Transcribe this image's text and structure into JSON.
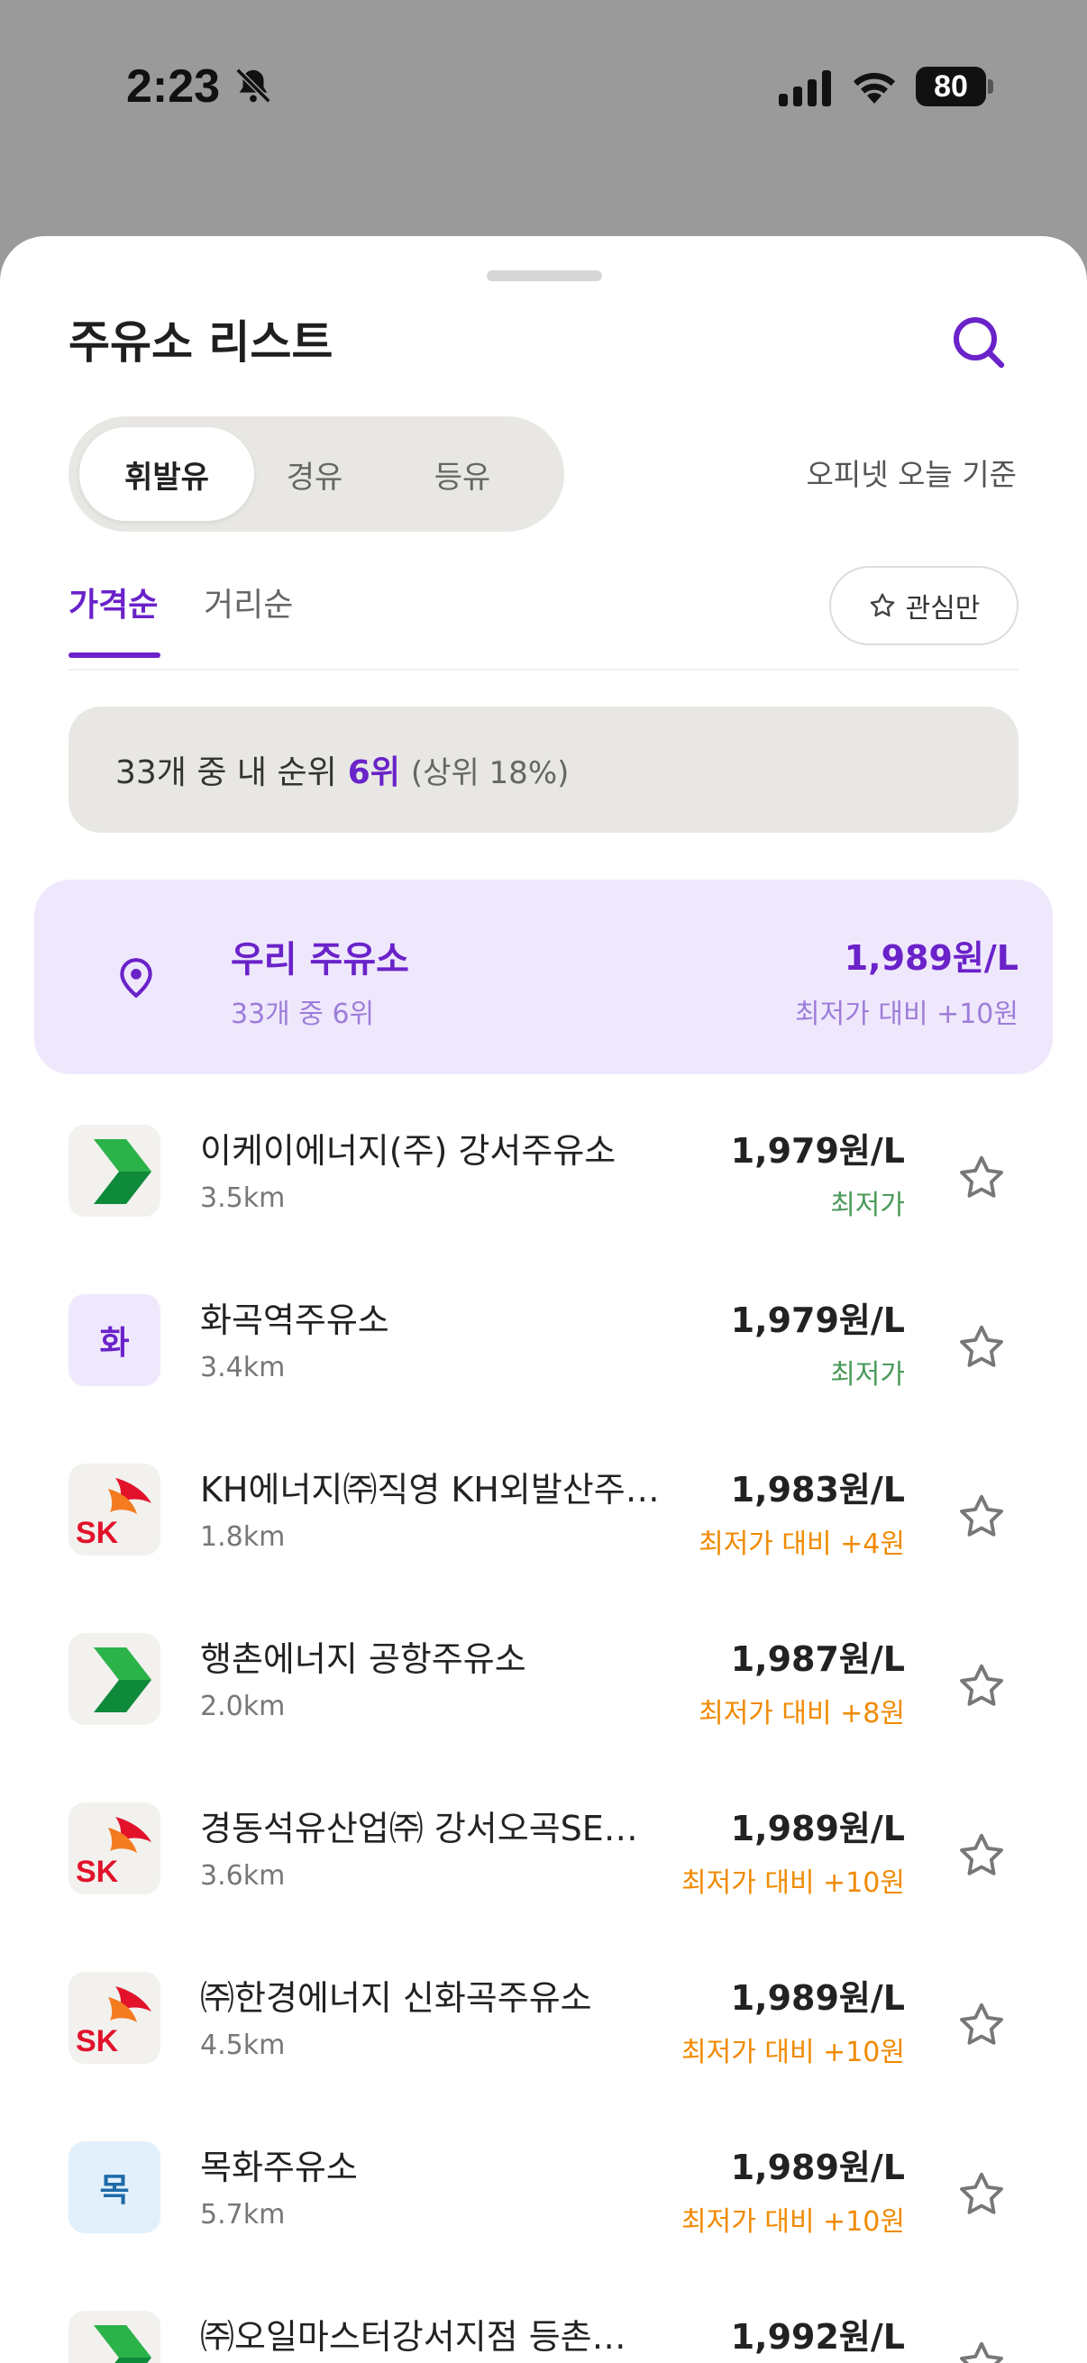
{
  "status_bar": {
    "time": "2:23",
    "battery": "80"
  },
  "sheet": {
    "title": "주유소 리스트",
    "fuel_types": [
      "휘발유",
      "경유",
      "등유"
    ],
    "selected_fuel": "휘발유",
    "note": "오피넷 오늘 기준",
    "sort_tabs": [
      "가격순",
      "거리순"
    ],
    "favorites_only_label": "관심만",
    "rank": {
      "prefix": "33개 중 내 순위",
      "rank": "6위",
      "sub": "(상위 18%)"
    },
    "my_station": {
      "name": "우리 주유소",
      "rank_text": "33개 중 6위",
      "price": "1,989원/L",
      "diff": "최저가 대비 +10원"
    },
    "stations": [
      {
        "name": "이케이에너지(주) 강서주유소",
        "distance": "3.5km",
        "price": "1,979원/L",
        "diff": "최저가",
        "level": "low",
        "logo": "green-arrow"
      },
      {
        "name": "화곡역주유소",
        "distance": "3.4km",
        "price": "1,979원/L",
        "diff": "최저가",
        "level": "low",
        "logo": "text",
        "logo_text": "화"
      },
      {
        "name": "KH에너지㈜직영 KH외발산주…",
        "distance": "1.8km",
        "price": "1,983원/L",
        "diff": "최저가 대비 +4원",
        "level": "up",
        "logo": "sk"
      },
      {
        "name": "행촌에너지 공항주유소",
        "distance": "2.0km",
        "price": "1,987원/L",
        "diff": "최저가 대비 +8원",
        "level": "up",
        "logo": "green-arrow"
      },
      {
        "name": "경동석유산업㈜ 강서오곡SE…",
        "distance": "3.6km",
        "price": "1,989원/L",
        "diff": "최저가 대비 +10원",
        "level": "up",
        "logo": "sk"
      },
      {
        "name": "㈜한경에너지 신화곡주유소",
        "distance": "4.5km",
        "price": "1,989원/L",
        "diff": "최저가 대비 +10원",
        "level": "up",
        "logo": "sk"
      },
      {
        "name": "목화주유소",
        "distance": "5.7km",
        "price": "1,989원/L",
        "diff": "최저가 대비 +10원",
        "level": "up",
        "logo": "text",
        "logo_text": "목"
      },
      {
        "name": "㈜오일마스터강서지점 등촌…",
        "distance": "",
        "price": "1,992원/L",
        "diff": "",
        "level": "up",
        "logo": "green-arrow"
      }
    ]
  },
  "colors": {
    "accent": "#6a22c9",
    "lowest": "#4a9a5a",
    "above": "#f08a00",
    "sk_red": "#e2122b",
    "sk_orange": "#f47b20"
  }
}
